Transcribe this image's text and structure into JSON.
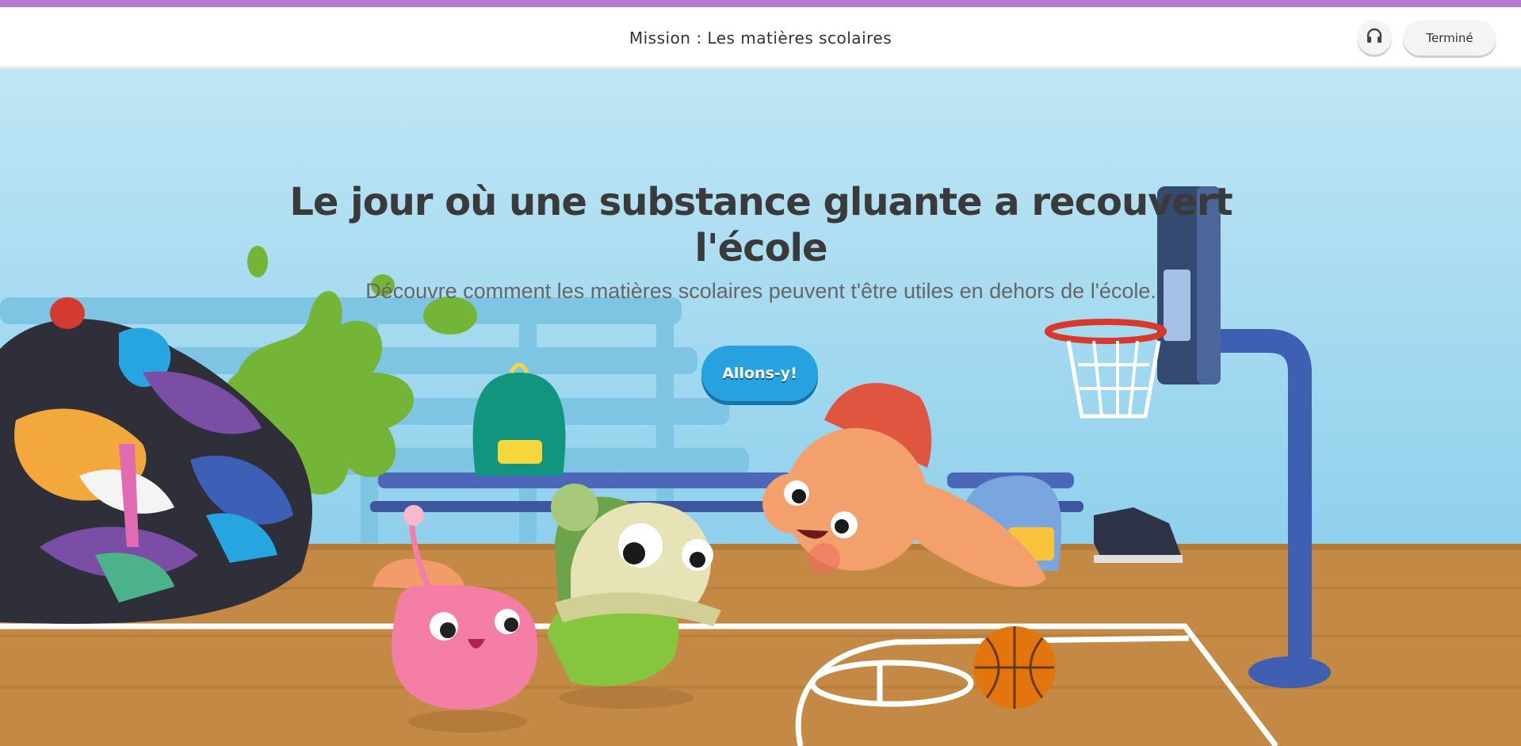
{
  "header": {
    "title": "Mission : Les matières scolaires",
    "audio_icon": "headphones-icon",
    "done_label": "Terminé"
  },
  "hero": {
    "title": "Le jour où une substance gluante a recouvert l'école",
    "subtitle": "Découvre comment les matières scolaires peuvent t'être utiles en dehors de l'école.",
    "cta_label": "Allons-y!"
  },
  "colors": {
    "accent_bar": "#b57ad6",
    "sky": "#a9dff2",
    "floor": "#c48a45",
    "cta": "#27a1e0"
  }
}
